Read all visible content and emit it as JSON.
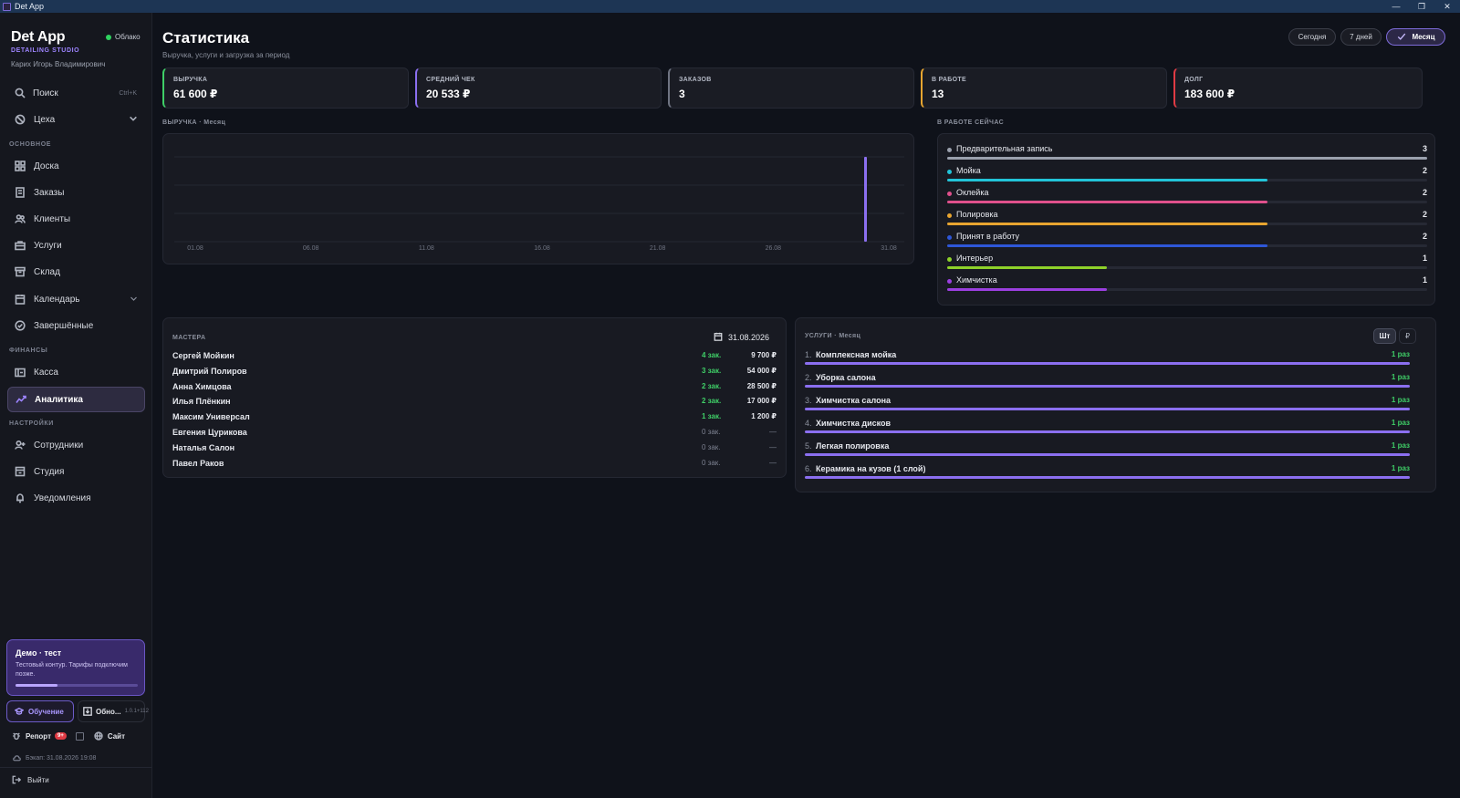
{
  "window": {
    "title": "Det App",
    "minimize": "—",
    "maximize": "❐",
    "close": "✕"
  },
  "sidebar": {
    "brand": {
      "title": "Det App",
      "subtitle": "DETAILING STUDIO",
      "user": "Карих Игорь Владимирович"
    },
    "cloud_status": "Облако",
    "search": {
      "label": "Поиск",
      "shortcut": "Ctrl+K"
    },
    "workshops": "Цеха",
    "sections": {
      "main": "ОСНОВНОЕ",
      "finance": "ФИНАНСЫ",
      "settings": "НАСТРОЙКИ"
    },
    "items": {
      "board": "Доска",
      "orders": "Заказы",
      "clients": "Клиенты",
      "services": "Услуги",
      "warehouse": "Склад",
      "calendar": "Календарь",
      "completed": "Завершённые",
      "cashbox": "Касса",
      "analytics": "Аналитика",
      "employees": "Сотрудники",
      "studio": "Студия",
      "notifications": "Уведомления"
    },
    "demo": {
      "title": "Демо · тест",
      "text": "Тестовый контур. Тарифы подключим позже.",
      "progress": 0.34
    },
    "learn_button": "Обучение",
    "update_button": "Обно...",
    "version": "1.0.1+112",
    "report": "Репорт",
    "report_badge": "9+",
    "site": "Сайт",
    "backup": "Бэкап: 31.08.2026 19:08",
    "logout": "Выйти"
  },
  "header": {
    "title": "Статистика",
    "subtitle": "Выручка, услуги и загрузка за период",
    "periods": [
      "Сегодня",
      "7 дней",
      "Месяц"
    ],
    "active_period": "Месяц"
  },
  "kpis": [
    {
      "label": "ВЫРУЧКА",
      "value": "61 600 ₽",
      "color": "#3fcf67"
    },
    {
      "label": "СРЕДНИЙ ЧЕК",
      "value": "20 533 ₽",
      "color": "#8b6ff0"
    },
    {
      "label": "ЗАКАЗОВ",
      "value": "3",
      "color": "#6f7482"
    },
    {
      "label": "В РАБОТЕ",
      "value": "13",
      "color": "#e8a530"
    },
    {
      "label": "ДОЛГ",
      "value": "183 600 ₽",
      "color": "#e03b44"
    }
  ],
  "chart_data": {
    "type": "bar",
    "title": "ВЫРУЧКА · Месяц",
    "x_ticks": [
      "01.08",
      "06.08",
      "11.08",
      "16.08",
      "21.08",
      "26.08",
      "31.08"
    ],
    "x_range": [
      1,
      31
    ],
    "bars": [
      {
        "day": 31,
        "value": 61600
      }
    ],
    "ylim": [
      0,
      61600
    ],
    "grid": true,
    "color": "#8b6ff0"
  },
  "work_now": {
    "title": "В РАБОТЕ СЕЙЧАС",
    "max": 3,
    "items": [
      {
        "name": "Предварительная запись",
        "count": 3,
        "color": "#9aa0ad"
      },
      {
        "name": "Мойка",
        "count": 2,
        "color": "#22c3d8"
      },
      {
        "name": "Оклейка",
        "count": 2,
        "color": "#e0508c"
      },
      {
        "name": "Полировка",
        "count": 2,
        "color": "#e8a530"
      },
      {
        "name": "Принят в работу",
        "count": 2,
        "color": "#2e57d8"
      },
      {
        "name": "Интерьер",
        "count": 1,
        "color": "#8ed12a"
      },
      {
        "name": "Химчистка",
        "count": 1,
        "color": "#9b3fe0"
      }
    ]
  },
  "masters": {
    "title": "МАСТЕРА",
    "date": "31.08.2026",
    "rows": [
      {
        "name": "Сергей Мойкин",
        "orders": "4 зак.",
        "sum": "9 700 ₽",
        "active": true
      },
      {
        "name": "Дмитрий Полиров",
        "orders": "3 зак.",
        "sum": "54 000 ₽",
        "active": true
      },
      {
        "name": "Анна Химцова",
        "orders": "2 зак.",
        "sum": "28 500 ₽",
        "active": true
      },
      {
        "name": "Илья Плёнкин",
        "orders": "2 зак.",
        "sum": "17 000 ₽",
        "active": true
      },
      {
        "name": "Максим Универсал",
        "orders": "1 зак.",
        "sum": "1 200 ₽",
        "active": true
      },
      {
        "name": "Евгения Цурикова",
        "orders": "0 зак.",
        "sum": "—",
        "active": false
      },
      {
        "name": "Наталья Салон",
        "orders": "0 зак.",
        "sum": "—",
        "active": false
      },
      {
        "name": "Павел Раков",
        "orders": "0 зак.",
        "sum": "—",
        "active": false
      }
    ]
  },
  "services_top": {
    "title": "УСЛУГИ · Месяц",
    "toggle": [
      "Шт",
      "₽"
    ],
    "active_toggle": "Шт",
    "rows": [
      {
        "index": "1.",
        "name": "Комплексная мойка",
        "times": "1 раз"
      },
      {
        "index": "2.",
        "name": "Уборка салона",
        "times": "1 раз"
      },
      {
        "index": "3.",
        "name": "Химчистка салона",
        "times": "1 раз"
      },
      {
        "index": "4.",
        "name": "Химчистка дисков",
        "times": "1 раз"
      },
      {
        "index": "5.",
        "name": "Легкая полировка",
        "times": "1 раз"
      },
      {
        "index": "6.",
        "name": "Керамика на кузов (1 слой)",
        "times": "1 раз"
      }
    ]
  }
}
